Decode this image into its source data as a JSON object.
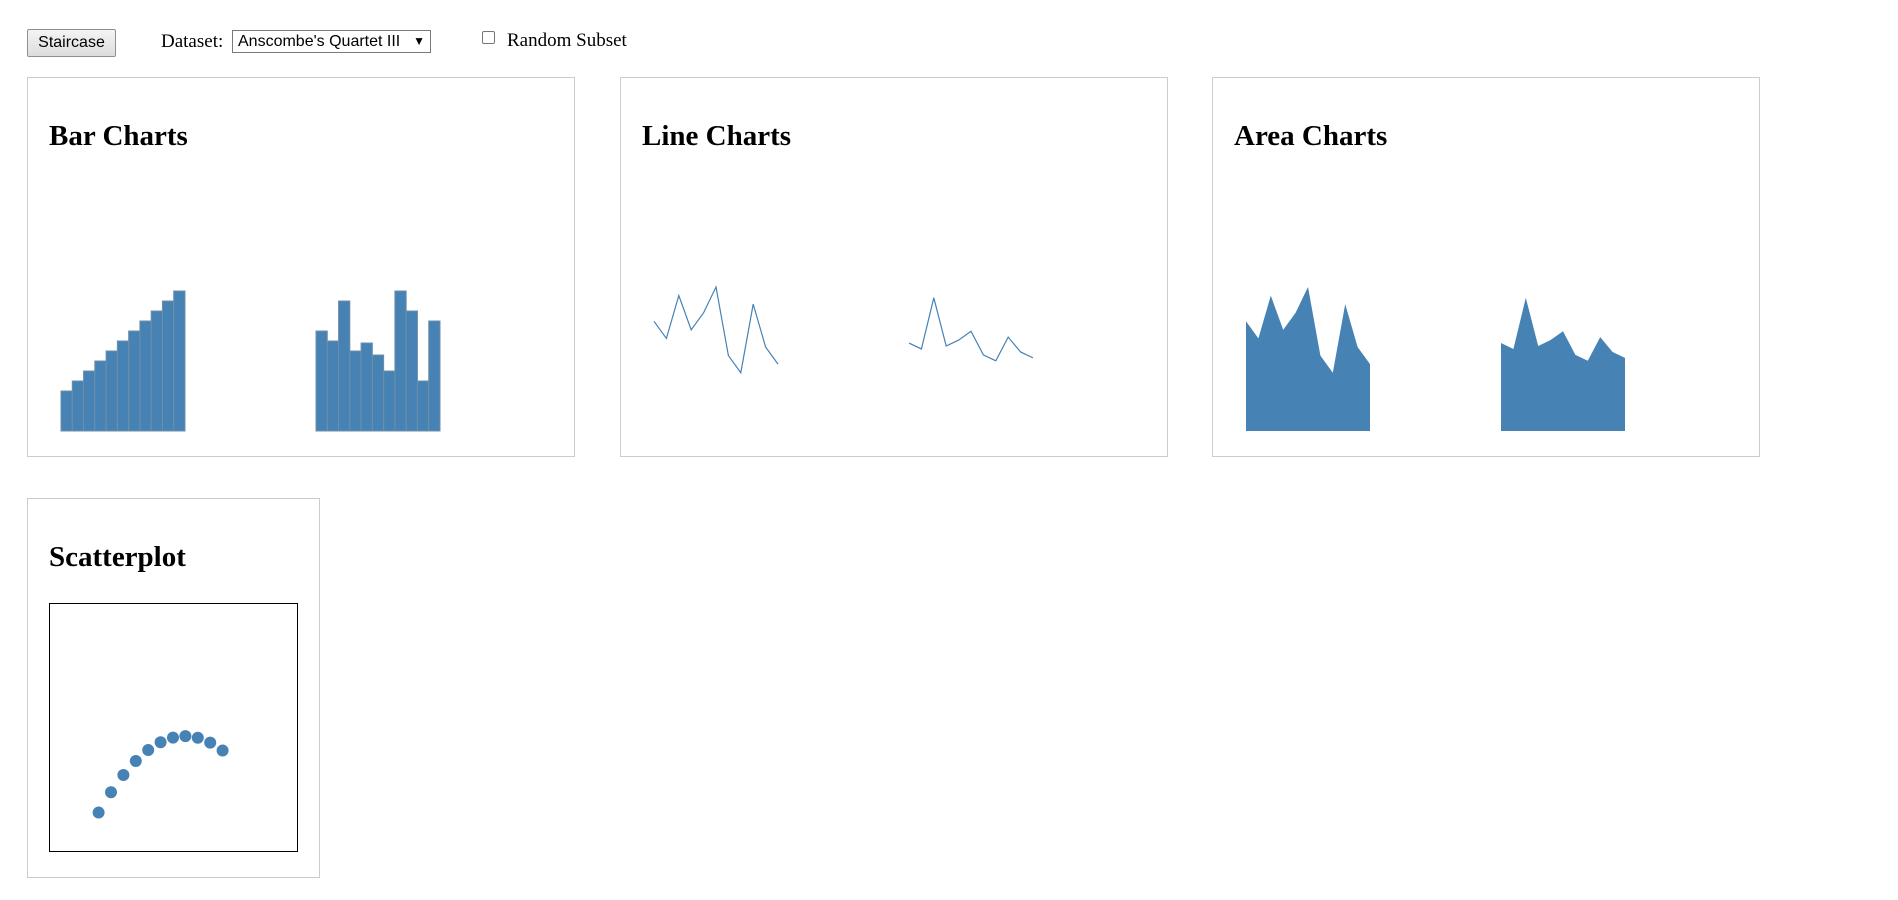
{
  "controls": {
    "staircase_label": "Staircase",
    "dataset_label": "Dataset:",
    "dataset_selected": "Anscombe's Quartet III",
    "random_subset_label": "Random Subset",
    "random_subset_checked": false
  },
  "panels": {
    "bar": {
      "title": "Bar Charts"
    },
    "line": {
      "title": "Line Charts"
    },
    "area": {
      "title": "Area Charts"
    },
    "scatter": {
      "title": "Scatterplot"
    }
  },
  "colors": {
    "mark": "#4682b4",
    "bar_stroke": "#6f8fa8",
    "panel_border": "#cccccc"
  },
  "chart_data": [
    {
      "type": "bar",
      "panel": "bar",
      "series": [
        {
          "values": [
            4,
            5,
            6,
            7,
            8,
            9,
            10,
            11,
            12,
            13,
            14
          ]
        },
        {
          "values": [
            10,
            9,
            13,
            8,
            8.8,
            7.6,
            6,
            14,
            12,
            5,
            11
          ]
        }
      ]
    },
    {
      "type": "line",
      "panel": "line",
      "series": [
        {
          "values": [
            10,
            8,
            13,
            9,
            11,
            14,
            6,
            4,
            12,
            7,
            5
          ]
        },
        {
          "values": [
            7.46,
            6.77,
            12.74,
            7.11,
            7.81,
            8.84,
            6.08,
            5.39,
            8.15,
            6.42,
            5.73
          ]
        }
      ]
    },
    {
      "type": "area",
      "panel": "area",
      "series": [
        {
          "values": [
            10,
            8,
            13,
            9,
            11,
            14,
            6,
            4,
            12,
            7,
            5
          ]
        },
        {
          "values": [
            7.46,
            6.77,
            12.74,
            7.11,
            7.81,
            8.84,
            6.08,
            5.39,
            8.15,
            6.42,
            5.73
          ]
        }
      ]
    },
    {
      "type": "scatter",
      "panel": "scatter",
      "x": [
        4,
        5,
        6,
        7,
        8,
        9,
        10,
        11,
        12,
        13,
        14
      ],
      "y": [
        3.1,
        4.74,
        6.13,
        7.26,
        8.14,
        8.77,
        9.14,
        9.26,
        9.13,
        8.74,
        8.1
      ],
      "xlim": [
        0,
        20
      ],
      "ylim": [
        0,
        20
      ]
    }
  ]
}
